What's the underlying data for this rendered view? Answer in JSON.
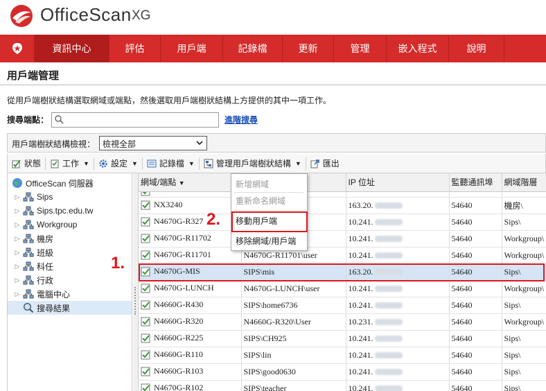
{
  "brand": {
    "name": "OfficeScan",
    "version": "XG"
  },
  "nav": {
    "items": [
      {
        "label": "資訊中心",
        "active": true
      },
      {
        "label": "評估"
      },
      {
        "label": "用戶端"
      },
      {
        "label": "記錄檔"
      },
      {
        "label": "更新"
      },
      {
        "label": "管理"
      },
      {
        "label": "嵌入程式"
      },
      {
        "label": "說明"
      }
    ]
  },
  "page": {
    "title": "用戶端管理",
    "description": "從用戶端樹狀結構選取網域或端點，然後選取用戶端樹狀結構上方提供的其中一項工作。"
  },
  "search": {
    "label": "搜尋端點：",
    "value": "",
    "advanced_link": "進階搜尋"
  },
  "view": {
    "label": "用戶端樹狀結構檢視：",
    "selected": "檢視全部"
  },
  "toolbar": {
    "status": "狀態",
    "tasks": "工作",
    "settings": "設定",
    "logs": "記錄檔",
    "manage_tree": "管理用戶端樹狀結構",
    "export": "匯出"
  },
  "tree": {
    "root": "OfficeScan 伺服器",
    "items": [
      "Sips",
      "Sips.tpc.edu.tw",
      "Workgroup",
      "機房",
      "班級",
      "科任",
      "行政",
      "電腦中心"
    ],
    "search_results": "搜尋結果"
  },
  "grid": {
    "columns": [
      "網域/端點",
      "",
      "IP 位址",
      "監聽通訊埠",
      "網域階層"
    ],
    "rows": [
      {
        "endpoint": "",
        "domain": "",
        "ip": "",
        "port": "",
        "hier": ""
      },
      {
        "endpoint": "NX3240",
        "domain": "tor",
        "ip": "163.20.",
        "port": "54640",
        "hier": "機房\\"
      },
      {
        "endpoint": "N4670G-R327",
        "domain": "",
        "ip": "10.241.",
        "port": "54640",
        "hier": "Sips\\"
      },
      {
        "endpoint": "N4670G-R11702",
        "domain": "ser",
        "ip": "10.241.",
        "port": "54640",
        "hier": "Workgroup\\"
      },
      {
        "endpoint": "N4670G-R11701",
        "domain": "N4670G-R11701\\user",
        "ip": "10.241.",
        "port": "54640",
        "hier": "Workgroup\\"
      },
      {
        "endpoint": "N4670G-MIS",
        "domain": "SIPS\\mis",
        "ip": "163.20.",
        "port": "54640",
        "hier": "Sips\\"
      },
      {
        "endpoint": "N4670G-LUNCH",
        "domain": "N4670G-LUNCH\\user",
        "ip": "10.241.",
        "port": "54640",
        "hier": "Workgroup\\"
      },
      {
        "endpoint": "N4660G-R430",
        "domain": "SIPS\\home6736",
        "ip": "10.241.",
        "port": "54640",
        "hier": "Sips\\"
      },
      {
        "endpoint": "N4660G-R320",
        "domain": "N4660G-R320\\User",
        "ip": "10.231.",
        "port": "54640",
        "hier": "Workgroup\\"
      },
      {
        "endpoint": "N4660G-R225",
        "domain": "SIPS\\CH925",
        "ip": "10.241.",
        "port": "54640",
        "hier": "Sips\\"
      },
      {
        "endpoint": "N4660G-R110",
        "domain": "SIPS\\lin",
        "ip": "10.241.",
        "port": "54640",
        "hier": "Sips\\"
      },
      {
        "endpoint": "N4660G-R103",
        "domain": "SIPS\\good0630",
        "ip": "10.241.",
        "port": "54640",
        "hier": "Sips\\"
      },
      {
        "endpoint": "N4670G-R102",
        "domain": "SIPS\\teacher",
        "ip": "10.241.",
        "port": "54640",
        "hier": "Sips\\"
      }
    ]
  },
  "menu": {
    "items": [
      {
        "label": "新增網域",
        "disabled": true
      },
      {
        "label": "重新命名網域",
        "disabled": true
      },
      {
        "label": "移動用戶端",
        "disabled": false
      },
      {
        "label": "移除網域/用戶端",
        "disabled": false
      }
    ]
  },
  "callouts": {
    "step1": "1.",
    "step2": "2."
  },
  "colors": {
    "brand_red": "#d52b2b",
    "nav_active": "#b11c1c",
    "callout_red": "#e0161b",
    "selection": "#d5e5f6",
    "online_icon": "#3a9a3a"
  }
}
